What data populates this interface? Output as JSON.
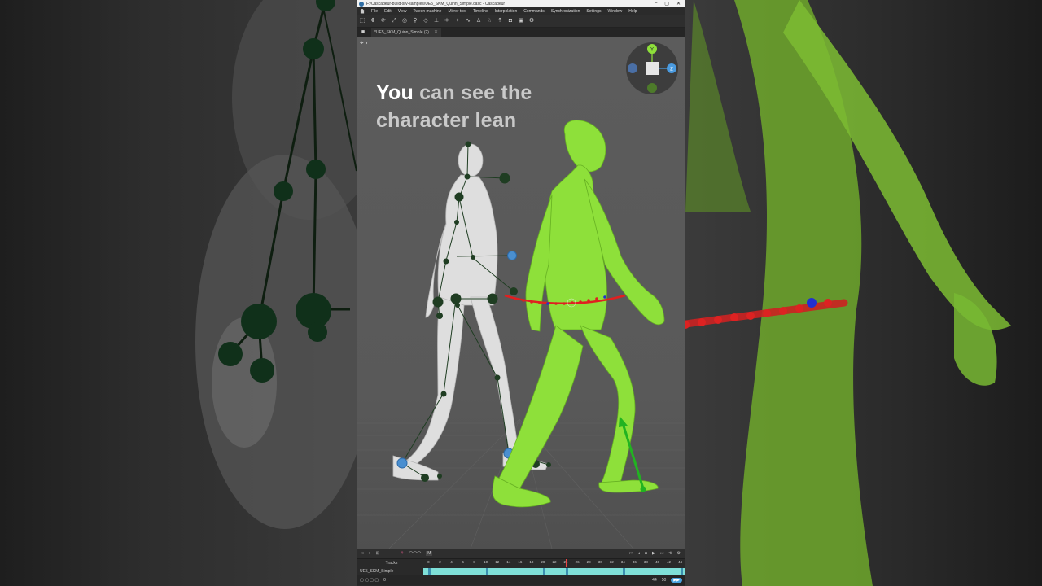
{
  "window": {
    "title": "F:/Cascadeur-build-srv-samples/UE5_SKM_Quinn_Simple.casc - Cascadeur",
    "controls": [
      "–",
      "▢",
      "✕"
    ]
  },
  "menu": [
    "File",
    "Edit",
    "View",
    "Tween machine",
    "Mirror tool",
    "Timeline",
    "Interpolation",
    "Commands",
    "Synchronization",
    "Settings",
    "Window",
    "Help"
  ],
  "toolbar_icons": [
    "select-icon",
    "move-icon",
    "rotate-icon",
    "scale-icon",
    "pivot-icon",
    "pin-icon",
    "ik-icon",
    "fulcrum-icon",
    "physics-icon",
    "autopose-icon",
    "interpolation-icon",
    "walk-icon",
    "run-icon",
    "jump-icon",
    "camera-icon",
    "render-icon",
    "settings-icon"
  ],
  "tab": {
    "label": "*UE5_SKM_Quinn_Simple (2)"
  },
  "caption": {
    "highlight": "You",
    "rest": " can see the",
    "line2": "character lean"
  },
  "gizmo": {
    "y": "Y",
    "z": "Z"
  },
  "timeline": {
    "tracks_label": "Tracks",
    "object_label": "UE5_SKM_Simple",
    "ticks": [
      "0",
      "2",
      "4",
      "6",
      "8",
      "10",
      "12",
      "14",
      "16",
      "18",
      "20",
      "22",
      "24",
      "26",
      "28",
      "30",
      "32",
      "34",
      "36",
      "38",
      "40",
      "42",
      "44"
    ],
    "playhead_frame": 24,
    "current_frame": "0",
    "end_frame_field": "44",
    "fps_field": "50",
    "mode_badge": "M",
    "colors": {
      "track": "#7fe0d8",
      "keys": "#3b8fb0",
      "playhead": "#e44444",
      "accent": "#4aa3e0"
    }
  },
  "colors": {
    "green_character": "#8ee03a",
    "white_character": "#dcdcdc",
    "joint": "#1f3d22",
    "controller": "#4a8fd0",
    "trajectory": "#e02020"
  }
}
